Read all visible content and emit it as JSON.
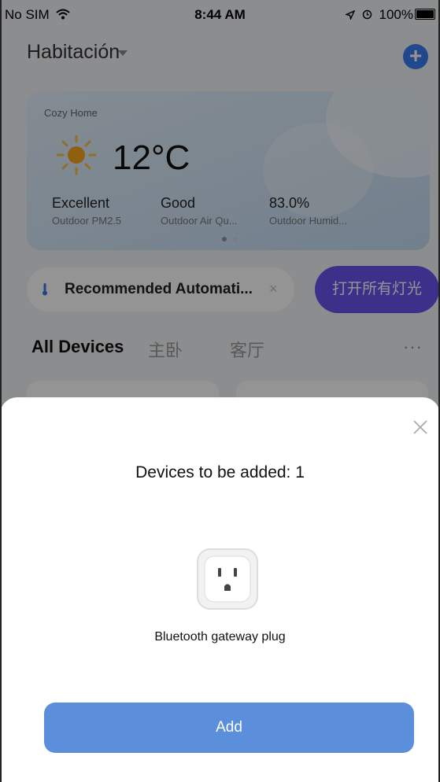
{
  "status_bar": {
    "carrier": "No SIM",
    "time": "8:44 AM",
    "battery": "100%"
  },
  "header": {
    "home_name": "Habitación"
  },
  "weather": {
    "home_label": "Cozy Home",
    "temperature": "12°C",
    "metrics": [
      {
        "value": "Excellent",
        "label": "Outdoor PM2.5"
      },
      {
        "value": "Good",
        "label": "Outdoor Air Qu..."
      },
      {
        "value": "83.0%",
        "label": "Outdoor Humid..."
      }
    ]
  },
  "automation": {
    "label": "Recommended Automati...",
    "close": "×"
  },
  "scene_button": {
    "label": "打开所有灯光"
  },
  "tabs": [
    {
      "label": "All Devices",
      "active": true
    },
    {
      "label": "主卧",
      "active": false
    },
    {
      "label": "客厅",
      "active": false
    }
  ],
  "more_label": "···",
  "sheet": {
    "title": "Devices to be added: 1",
    "device_name": "Bluetooth gateway plug",
    "add_label": "Add"
  },
  "colors": {
    "accent_blue": "#3b7cf2",
    "scene_purple": "#6655ee",
    "add_button": "#5b8fdc"
  }
}
